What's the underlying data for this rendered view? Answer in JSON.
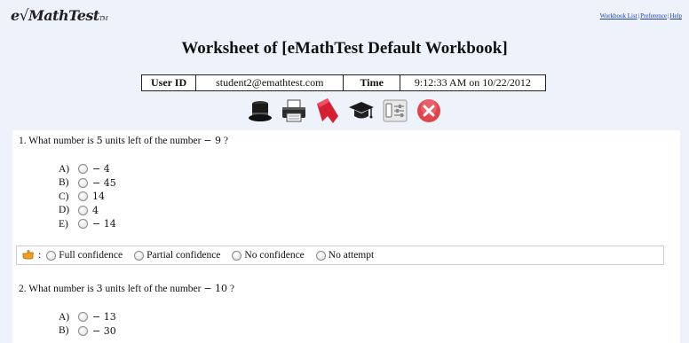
{
  "header": {
    "logo": {
      "prefix": "e",
      "radical": "√",
      "text": "MathTest",
      "tm": "TM"
    },
    "links": [
      "Workbook List",
      "Preference",
      "Help"
    ],
    "separator": "|"
  },
  "title": "Worksheet of [eMathTest Default Workbook]",
  "info": {
    "user_id_label": "User ID",
    "user_id": "student2@emathtest.com",
    "time_label": "Time",
    "time": "9:12:33 AM on 10/22/2012"
  },
  "toolbar": {
    "icons": [
      "top-hat-icon",
      "printer-icon",
      "bookmark-flag-icon",
      "graduation-cap-icon",
      "settings-panel-icon",
      "close-icon"
    ]
  },
  "questions": [
    {
      "prefix": "1. What number is ",
      "n": "5",
      "middle": " units left of the number ",
      "num": "− 9",
      "suffix": " ?",
      "choices": [
        {
          "letter": "A)",
          "value": "− 4"
        },
        {
          "letter": "B)",
          "value": "− 45"
        },
        {
          "letter": "C)",
          "value": "14"
        },
        {
          "letter": "D)",
          "value": "4"
        },
        {
          "letter": "E)",
          "value": "− 14"
        }
      ]
    },
    {
      "prefix": "2. What number is ",
      "n": "3",
      "middle": " units left of the number ",
      "num": "− 10",
      "suffix": " ?",
      "choices": [
        {
          "letter": "A)",
          "value": "− 13"
        },
        {
          "letter": "B)",
          "value": "− 30"
        }
      ]
    }
  ],
  "confidence": {
    "separator": ":",
    "options": [
      "Full confidence",
      "Partial confidence",
      "No confidence",
      "No attempt"
    ]
  }
}
